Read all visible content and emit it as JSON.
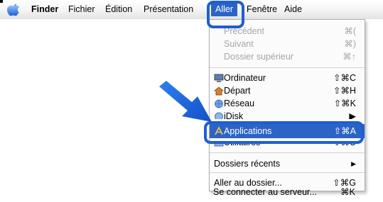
{
  "menubar": {
    "finder": "Finder",
    "items": [
      "Fichier",
      "Édition",
      "Présentation",
      "Aller",
      "Fenêtre",
      "Aide"
    ]
  },
  "menu": {
    "precedent": {
      "label": "Précédent",
      "shortcut": "⌘("
    },
    "suivant": {
      "label": "Suivant",
      "shortcut": "⌘)"
    },
    "dossier_sup": {
      "label": "Dossier supérieur",
      "shortcut": "⌘↑"
    },
    "ordinateur": {
      "label": "Ordinateur",
      "shortcut": "⇧⌘C"
    },
    "depart": {
      "label": "Départ",
      "shortcut": "⇧⌘H"
    },
    "reseau": {
      "label": "Réseau",
      "shortcut": "⇧⌘K"
    },
    "idisk": {
      "label": "iDisk",
      "shortcut": "▶"
    },
    "applications": {
      "label": "Applications",
      "shortcut": "⇧⌘A"
    },
    "utilitaires": {
      "label": "Utilitaires",
      "shortcut": "⇧⌘U"
    },
    "recents": {
      "label": "Dossiers récents",
      "shortcut": "▶"
    },
    "aller_dossier": {
      "label": "Aller au dossier...",
      "shortcut": "⇧⌘G"
    },
    "connecter": {
      "label": "Se connecter au serveur...",
      "shortcut": "⌘K"
    }
  },
  "colors": {
    "highlight": "#2b64c6",
    "callout": "#1f5fd0"
  },
  "icons": [
    "apple-icon",
    "computer-icon",
    "home-icon",
    "network-icon",
    "idisk-icon",
    "applications-icon",
    "utilities-icon",
    "callout-arrow-icon"
  ]
}
